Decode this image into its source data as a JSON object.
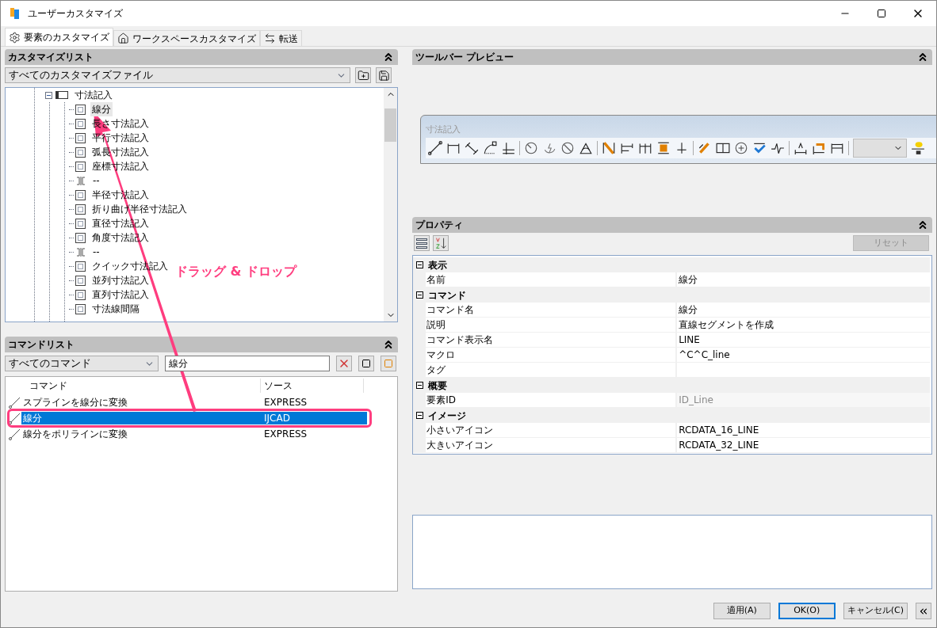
{
  "window": {
    "title": "ユーザーカスタマイズ"
  },
  "tabs": [
    {
      "label": "要素のカスタマイズ",
      "selected": true,
      "kind": "gear"
    },
    {
      "label": "ワークスペースカスタマイズ",
      "selected": false,
      "kind": "home"
    },
    {
      "label": "転送",
      "selected": false,
      "kind": "transfer"
    }
  ],
  "customize_list": {
    "title": "カスタマイズリスト",
    "file_select": "すべてのカスタマイズファイル",
    "tree": [
      {
        "label": "寸法記入",
        "expanded": true,
        "children": [
          {
            "label": "線分",
            "kind": "command",
            "selected": true
          },
          {
            "label": "長さ寸法記入",
            "kind": "command",
            "selected": false
          },
          {
            "label": "平行寸法記入",
            "kind": "command",
            "selected": false
          },
          {
            "label": "弧長寸法記入",
            "kind": "command",
            "selected": false
          },
          {
            "label": "座標寸法記入",
            "kind": "command",
            "selected": false
          },
          {
            "label": "--",
            "kind": "separator",
            "selected": false
          },
          {
            "label": "半径寸法記入",
            "kind": "command",
            "selected": false
          },
          {
            "label": "折り曲げ半径寸法記入",
            "kind": "command",
            "selected": false
          },
          {
            "label": "直径寸法記入",
            "kind": "command",
            "selected": false
          },
          {
            "label": "角度寸法記入",
            "kind": "command",
            "selected": false
          },
          {
            "label": "--",
            "kind": "separator",
            "selected": false
          },
          {
            "label": "クイック寸法記入",
            "kind": "command",
            "selected": false
          },
          {
            "label": "並列寸法記入",
            "kind": "command",
            "selected": false
          },
          {
            "label": "直列寸法記入",
            "kind": "command",
            "selected": false
          },
          {
            "label": "寸法線間隔",
            "kind": "command",
            "selected": false
          }
        ]
      }
    ]
  },
  "command_list": {
    "title": "コマンドリスト",
    "filter": "すべてのコマンド",
    "search": "線分",
    "columns": [
      "コマンド",
      "ソース"
    ],
    "rows": [
      {
        "command": "スプラインを線分に変換",
        "source": "EXPRESS",
        "selected": false
      },
      {
        "command": "線分",
        "source": "IJCAD",
        "selected": true
      },
      {
        "command": "線分をポリラインに変換",
        "source": "EXPRESS",
        "selected": false
      }
    ]
  },
  "toolbar_preview": {
    "title": "ツールバー プレビュー",
    "toolbar_name": "寸法記入"
  },
  "properties": {
    "title": "プロパティ",
    "reset": "リセット",
    "groups": [
      {
        "name": "表示",
        "expanded": true,
        "rows": [
          {
            "label": "名前",
            "value": "線分",
            "disabled": false
          }
        ]
      },
      {
        "name": "コマンド",
        "expanded": true,
        "rows": [
          {
            "label": "コマンド名",
            "value": "線分",
            "disabled": false
          },
          {
            "label": "説明",
            "value": "直線セグメントを作成",
            "disabled": false
          },
          {
            "label": "コマンド表示名",
            "value": "LINE",
            "disabled": false
          },
          {
            "label": "マクロ",
            "value": "^C^C_line",
            "disabled": false
          },
          {
            "label": "タグ",
            "disabled": false
          }
        ]
      },
      {
        "name": "概要",
        "expanded": true,
        "rows": [
          {
            "label": "要素ID",
            "value": "ID_Line",
            "disabled": true
          }
        ]
      },
      {
        "name": "イメージ",
        "expanded": true,
        "rows": [
          {
            "label": "小さいアイコン",
            "value": "RCDATA_16_LINE",
            "disabled": false
          },
          {
            "label": "大きいアイコン",
            "value": "RCDATA_32_LINE",
            "disabled": false
          }
        ]
      }
    ]
  },
  "buttons": [
    {
      "label": "適用(A)",
      "default": false
    },
    {
      "label": "OK(O)",
      "default": true
    },
    {
      "label": "キャンセル(C)",
      "default": false
    }
  ],
  "annotation": {
    "text": "ドラッグ & ドロップ"
  }
}
